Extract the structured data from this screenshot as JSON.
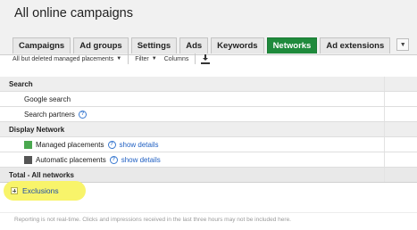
{
  "header": {
    "title": "All online campaigns",
    "tabs": [
      {
        "label": "Campaigns",
        "active": false
      },
      {
        "label": "Ad groups",
        "active": false
      },
      {
        "label": "Settings",
        "active": false
      },
      {
        "label": "Ads",
        "active": false
      },
      {
        "label": "Keywords",
        "active": false
      },
      {
        "label": "Networks",
        "active": true
      },
      {
        "label": "Ad extensions",
        "active": false
      }
    ],
    "more_icon": "chevron-down-icon"
  },
  "toolbar": {
    "filter_status": "All but deleted managed placements",
    "filter": "Filter",
    "columns": "Columns",
    "download_icon": "download-icon"
  },
  "table": {
    "search_section": "Search",
    "google_search": "Google search",
    "search_partners": "Search partners",
    "display_section": "Display Network",
    "managed_placements": "Managed placements",
    "automatic_placements": "Automatic placements",
    "show_details": "show details",
    "total": "Total - All networks",
    "help_glyph": "?"
  },
  "colors": {
    "active_tab": "#1f8a3c",
    "managed_swatch": "#4aa84f",
    "automatic_swatch": "#555555",
    "highlight": "#f8f46a",
    "link": "#1f5fc2"
  },
  "exclusions": {
    "label": "Exclusions",
    "icon": "expand-plus-icon"
  },
  "footer": {
    "note": "Reporting is not real-time. Clicks and impressions received in the last three hours may not be included here."
  }
}
